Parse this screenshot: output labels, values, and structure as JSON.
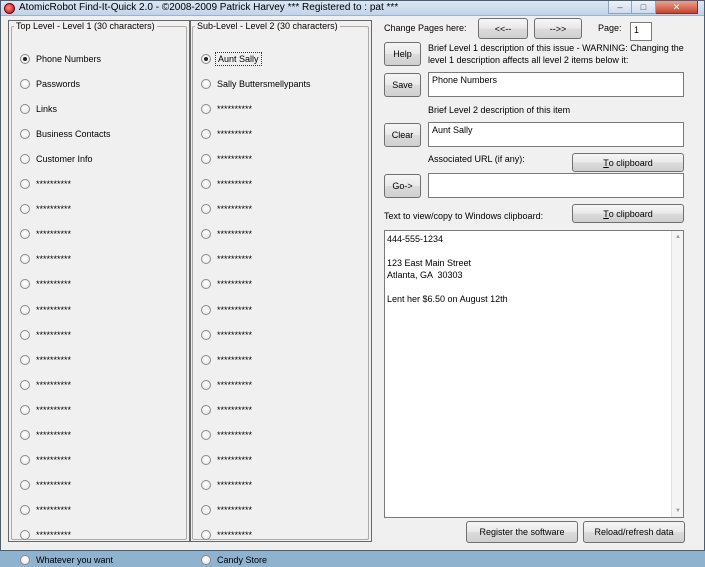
{
  "window": {
    "title": "AtomicRobot Find-It-Quick 2.0 - ©2008-2009 Patrick Harvey *** Registered to : pat ***",
    "minimize": "–",
    "maximize": "□",
    "close": "✕"
  },
  "level1": {
    "legend": "Top Level - Level 1 (30 characters)",
    "items": [
      {
        "label": "Phone Numbers",
        "checked": true
      },
      {
        "label": "Passwords"
      },
      {
        "label": "Links"
      },
      {
        "label": "Business Contacts"
      },
      {
        "label": "Customer Info"
      },
      {
        "label": "**********"
      },
      {
        "label": "**********"
      },
      {
        "label": "**********"
      },
      {
        "label": "**********"
      },
      {
        "label": "**********"
      },
      {
        "label": "**********"
      },
      {
        "label": "**********"
      },
      {
        "label": "**********"
      },
      {
        "label": "**********"
      },
      {
        "label": "**********"
      },
      {
        "label": "**********"
      },
      {
        "label": "**********"
      },
      {
        "label": "**********"
      },
      {
        "label": "**********"
      },
      {
        "label": "**********"
      },
      {
        "label": "Whatever you want"
      }
    ]
  },
  "level2": {
    "legend": "Sub-Level - Level 2 (30 characters)",
    "items": [
      {
        "label": "Aunt Sally",
        "checked": true
      },
      {
        "label": "Sally Buttersmellypants"
      },
      {
        "label": "**********"
      },
      {
        "label": "**********"
      },
      {
        "label": "**********"
      },
      {
        "label": "**********"
      },
      {
        "label": "**********"
      },
      {
        "label": "**********"
      },
      {
        "label": "**********"
      },
      {
        "label": "**********"
      },
      {
        "label": "**********"
      },
      {
        "label": "**********"
      },
      {
        "label": "**********"
      },
      {
        "label": "**********"
      },
      {
        "label": "**********"
      },
      {
        "label": "**********"
      },
      {
        "label": "**********"
      },
      {
        "label": "**********"
      },
      {
        "label": "**********"
      },
      {
        "label": "**********"
      },
      {
        "label": "Candy Store"
      }
    ]
  },
  "paging": {
    "label": "Change Pages here:",
    "prev_label": "<<--",
    "next_label": "-->>",
    "page_label": "Page:",
    "page_value": "1"
  },
  "actions": {
    "help": "Help",
    "save": "Save",
    "clear": "Clear",
    "go": "Go->"
  },
  "level1_desc": {
    "label": "Brief Level 1 description of this issue - WARNING: Changing the level 1 description affects all level 2 items below it:",
    "value": "Phone Numbers"
  },
  "level2_desc": {
    "label": "Brief Level 2 description of this item",
    "value": "Aunt Sally"
  },
  "url": {
    "label": "Associated URL (if any):",
    "value": "",
    "clipboard_mnemonic": "T",
    "clipboard_rest": "o clipboard"
  },
  "clipboard_text": {
    "label": "Text to view/copy to Windows clipboard:",
    "clipboard_mnemonic": "T",
    "clipboard_rest": "o clipboard",
    "value": "444-555-1234\n\n123 East Main Street\nAtlanta, GA  30303\n\nLent her $6.50 on August 12th"
  },
  "footer": {
    "register": "Register the software",
    "reload": "Reload/refresh data"
  }
}
